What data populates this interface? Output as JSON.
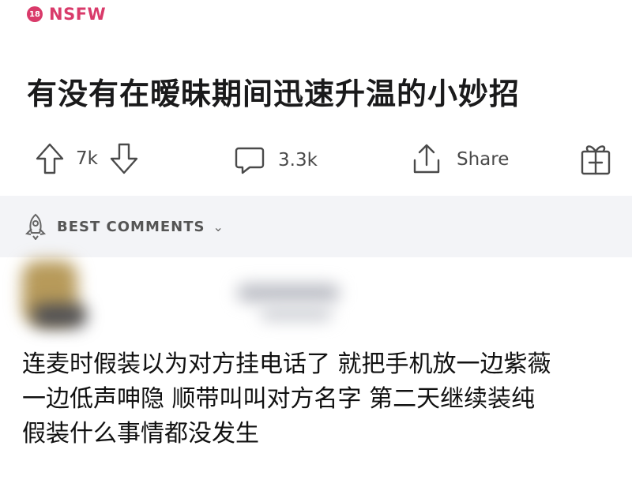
{
  "nsfw": {
    "badge": "18",
    "label": "NSFW"
  },
  "post": {
    "title": "有没有在暧昧期间迅速升温的小妙招"
  },
  "actions": {
    "upvotes": "7k",
    "comments": "3.3k",
    "share_label": "Share"
  },
  "comments_section": {
    "sort_label": "BEST COMMENTS"
  },
  "comment": {
    "lines": [
      "连麦时假装以为对方挂电话了 就把手机放一边紫薇",
      "一边低声呻隐 顺带叫叫对方名字 第二天继续装纯",
      "假装什么事情都没发生"
    ]
  },
  "colors": {
    "nsfw": "#d93a6a",
    "bar_bg": "#f3f4f7",
    "icon": "#4a4a4a"
  }
}
